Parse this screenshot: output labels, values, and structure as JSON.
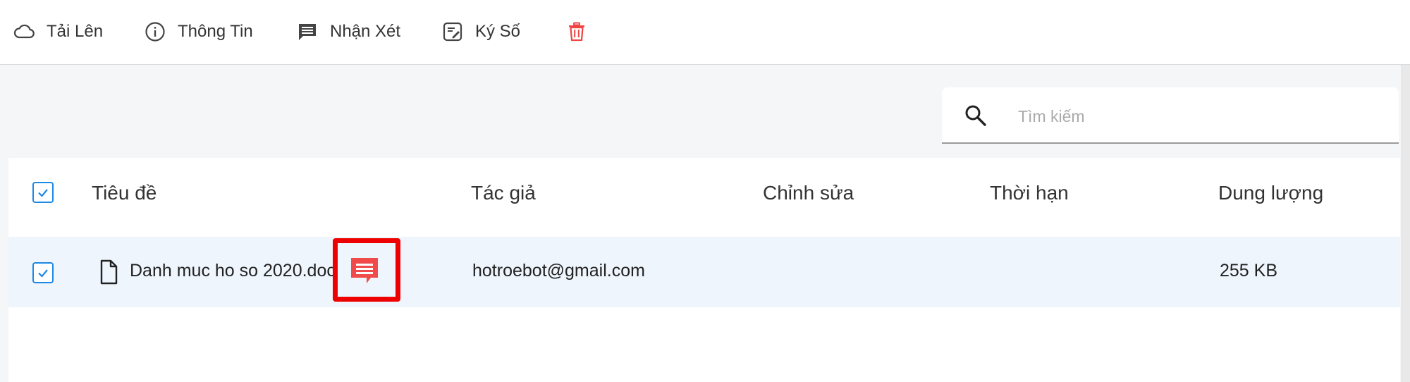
{
  "toolbar": {
    "upload_label": "Tải Lên",
    "info_label": "Thông Tin",
    "comment_label": "Nhận Xét",
    "sign_label": "Ký Số",
    "delete_color": "#f04444"
  },
  "search": {
    "placeholder": "Tìm kiếm"
  },
  "table": {
    "columns": {
      "title": "Tiêu đề",
      "author": "Tác giả",
      "modified": "Chỉnh sửa",
      "deadline": "Thời hạn",
      "size": "Dung lượng"
    },
    "header_checked": true,
    "rows": [
      {
        "checked": true,
        "title": "Danh muc ho so 2020.doc",
        "author": "hotroebot@gmail.com",
        "modified": "",
        "deadline": "",
        "size": "255 KB",
        "has_comment": true
      }
    ]
  },
  "colors": {
    "accent": "#1e88e5",
    "selected_row": "#eef5fd",
    "comment_badge": "#f04a4a",
    "highlight_box": "#ee0000"
  }
}
